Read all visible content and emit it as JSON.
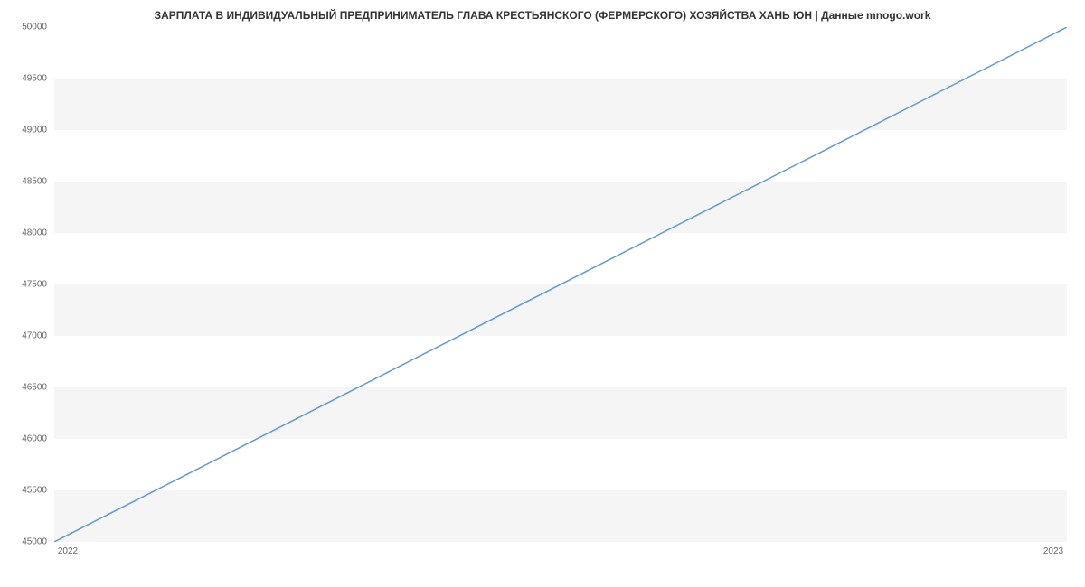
{
  "chart_data": {
    "type": "line",
    "title": "ЗАРПЛАТА В ИНДИВИДУАЛЬНЫЙ ПРЕДПРИНИМАТЕЛЬ ГЛАВА КРЕСТЬЯНСКОГО (ФЕРМЕРСКОГО) ХОЗЯЙСТВА ХАНЬ ЮН | Данные mnogo.work",
    "x": [
      "2022",
      "2023"
    ],
    "values": [
      45000,
      50000
    ],
    "xlabel": "",
    "ylabel": "",
    "ylim": [
      45000,
      50000
    ],
    "y_ticks": [
      45000,
      45500,
      46000,
      46500,
      47000,
      47500,
      48000,
      48500,
      49000,
      49500,
      50000
    ],
    "x_ticks": [
      "2022",
      "2023"
    ],
    "line_color": "#6699cc"
  }
}
